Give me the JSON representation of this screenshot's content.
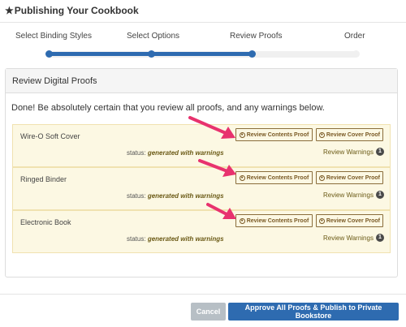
{
  "header": {
    "star_icon": "★",
    "title": "Publishing Your Cookbook"
  },
  "steps": {
    "items": [
      {
        "label": "Select Binding Styles",
        "complete": true
      },
      {
        "label": "Select Options",
        "complete": true
      },
      {
        "label": "Review Proofs",
        "complete": true
      },
      {
        "label": "Order",
        "complete": false
      }
    ],
    "progress_fraction": 0.67
  },
  "panel": {
    "heading": "Review Digital Proofs",
    "intro": "Done! Be absolutely certain that you review all proofs, and any warnings below.",
    "rows": [
      {
        "name": "Wire-O Soft Cover",
        "contents_button": "Review Contents Proof",
        "cover_button": "Review Cover Proof",
        "status_prefix": "status:",
        "status_value": "generated with warnings",
        "warnings_label": "Review Warnings",
        "warnings_count": "1"
      },
      {
        "name": "Ringed Binder",
        "contents_button": "Review Contents Proof",
        "cover_button": "Review Cover Proof",
        "status_prefix": "status:",
        "status_value": "generated with warnings",
        "warnings_label": "Review Warnings",
        "warnings_count": "1"
      },
      {
        "name": "Electronic Book",
        "contents_button": "Review Contents Proof",
        "cover_button": "Review Cover Proof",
        "status_prefix": "status:",
        "status_value": "generated with warnings",
        "warnings_label": "Review Warnings",
        "warnings_count": "1"
      }
    ]
  },
  "footer": {
    "cancel_label": "Cancel",
    "approve_label": "Approve All Proofs & Publish to Private Bookstore"
  },
  "icons": {
    "button_icon": "eye-icon",
    "annotation_arrow": "pink-arrow-icon"
  },
  "colors": {
    "primary": "#2e6bb0",
    "row_background": "#fcf8e3",
    "annotation_arrow": "#e8326e",
    "cancel": "#b7bfc5"
  }
}
